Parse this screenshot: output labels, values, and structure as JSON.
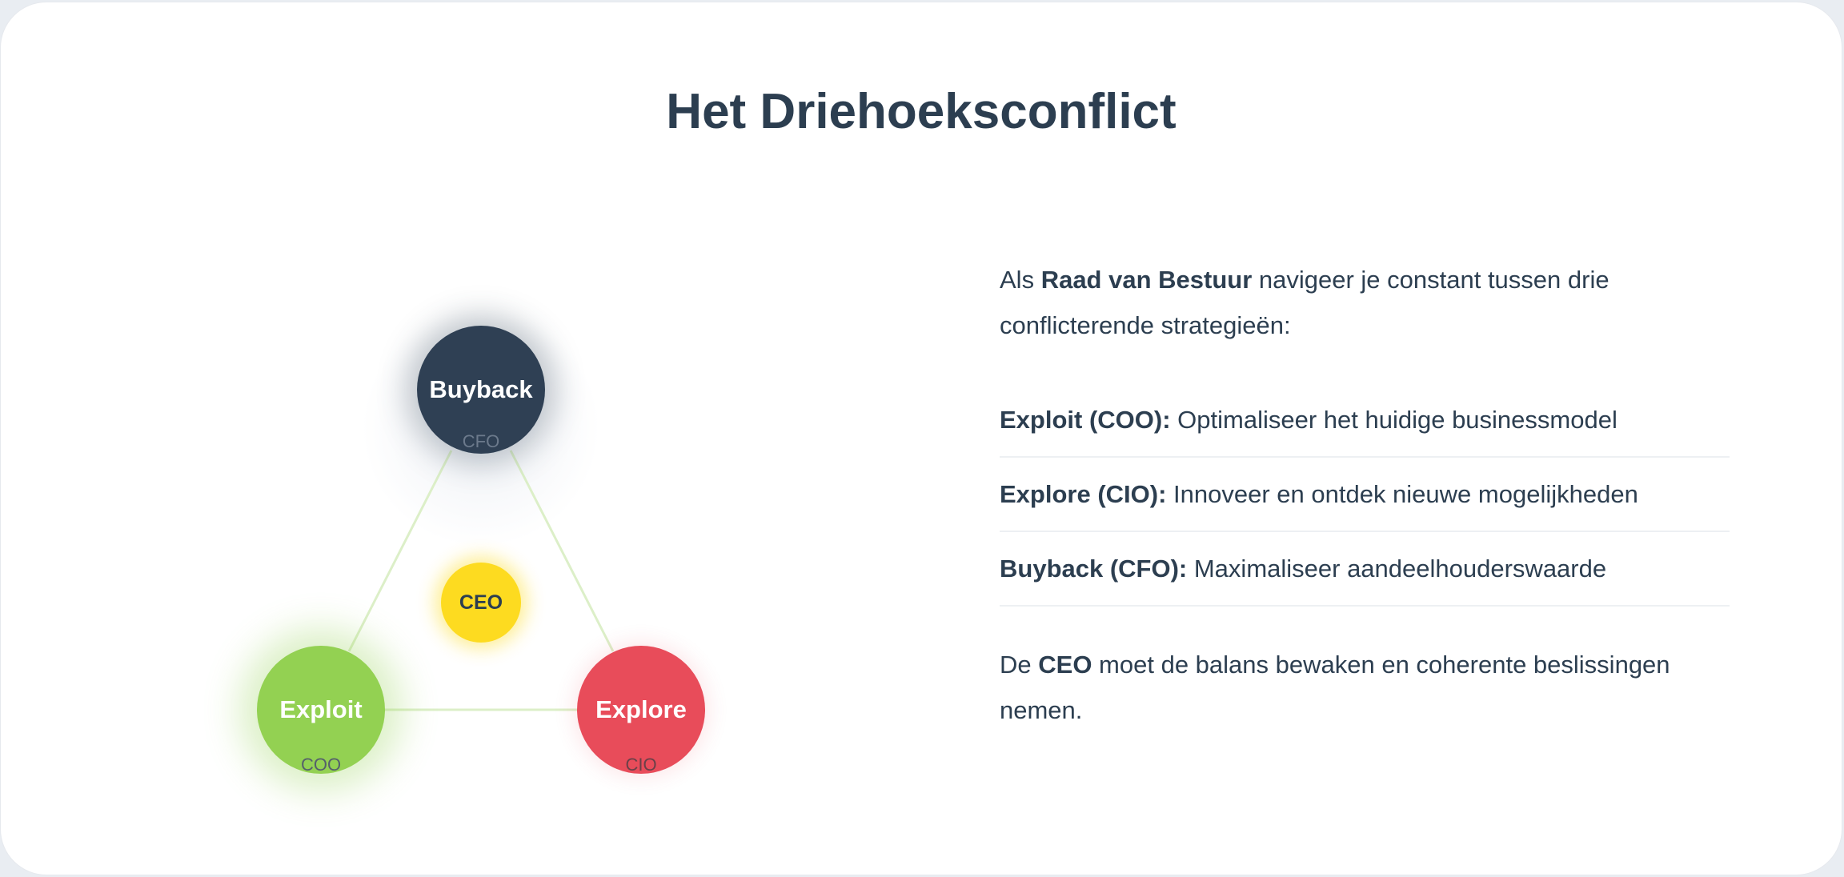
{
  "title": "Het Driehoeksconflict",
  "diagram": {
    "nodes": {
      "buyback": {
        "label": "Buyback",
        "role": "CFO",
        "color": "#2f4054"
      },
      "exploit": {
        "label": "Exploit",
        "role": "COO",
        "color": "#93d152"
      },
      "explore": {
        "label": "Explore",
        "role": "CIO",
        "color": "#e84c5a"
      },
      "ceo": {
        "label": "CEO",
        "color": "#fddb20"
      }
    },
    "line_color": "#dcefc8"
  },
  "text": {
    "intro": {
      "pre": "Als ",
      "bold": "Raad van Bestuur",
      "post": " navigeer je constant tussen drie conflicterende strategieën:"
    },
    "items": [
      {
        "head": "Exploit (COO):",
        "desc": " Optimaliseer het huidige businessmodel"
      },
      {
        "head": "Explore (CIO):",
        "desc": " Innoveer en ontdek nieuwe mogelijkheden"
      },
      {
        "head": "Buyback (CFO):",
        "desc": " Maximaliseer aandeelhouderswaarde"
      }
    ],
    "outro": {
      "pre": "De ",
      "bold": "CEO",
      "post": " moet de balans bewaken en coherente beslissingen nemen."
    }
  }
}
